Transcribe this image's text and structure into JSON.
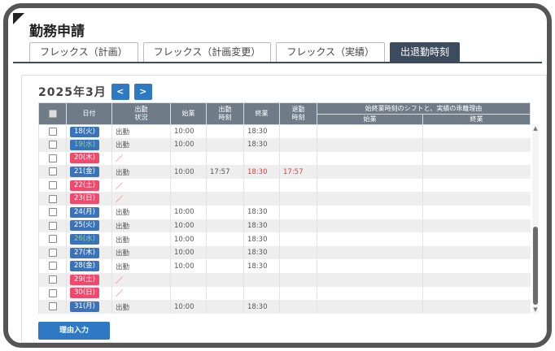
{
  "page_title": "勤務申請",
  "tabs": [
    {
      "label": "フレックス（計画）",
      "active": false
    },
    {
      "label": "フレックス（計画変更）",
      "active": false
    },
    {
      "label": "フレックス（実績）",
      "active": false
    },
    {
      "label": "出退勤時刻",
      "active": true
    }
  ],
  "month_label": "2025年3月",
  "nav": {
    "prev": "<",
    "next": ">"
  },
  "table": {
    "headers": {
      "date": "日付",
      "status": "出勤\n状況",
      "start": "始業",
      "clock_in": "出勤\n時刻",
      "end": "終業",
      "clock_out": "退勤\n時刻",
      "reason_group": "始終業時刻のシフトと、実績の乖離理由",
      "reason_start": "始業",
      "reason_end": "終業"
    },
    "rows": [
      {
        "date": "18(火)",
        "day_type": "weekday",
        "status": "出勤",
        "start": "10:00",
        "clock_in": "",
        "end": "18:30",
        "clock_out": "",
        "late": false
      },
      {
        "date": "19(水)",
        "day_type": "holiday",
        "status": "出勤",
        "start": "10:00",
        "clock_in": "",
        "end": "18:30",
        "clock_out": "",
        "late": false
      },
      {
        "date": "20(木)",
        "day_type": "weekend",
        "status": "／",
        "start": "",
        "clock_in": "",
        "end": "",
        "clock_out": "",
        "late": false
      },
      {
        "date": "21(金)",
        "day_type": "weekday",
        "status": "出勤",
        "start": "10:00",
        "clock_in": "17:57",
        "end": "18:30",
        "clock_out": "17:57",
        "late": true
      },
      {
        "date": "22(土)",
        "day_type": "weekend",
        "status": "／",
        "start": "",
        "clock_in": "",
        "end": "",
        "clock_out": "",
        "late": false
      },
      {
        "date": "23(日)",
        "day_type": "weekend",
        "status": "／",
        "start": "",
        "clock_in": "",
        "end": "",
        "clock_out": "",
        "late": false
      },
      {
        "date": "24(月)",
        "day_type": "weekday",
        "status": "出勤",
        "start": "10:00",
        "clock_in": "",
        "end": "18:30",
        "clock_out": "",
        "late": false
      },
      {
        "date": "25(火)",
        "day_type": "weekday",
        "status": "出勤",
        "start": "10:00",
        "clock_in": "",
        "end": "18:30",
        "clock_out": "",
        "late": false
      },
      {
        "date": "26(水)",
        "day_type": "holiday",
        "status": "出勤",
        "start": "10:00",
        "clock_in": "",
        "end": "18:30",
        "clock_out": "",
        "late": false
      },
      {
        "date": "27(木)",
        "day_type": "weekday",
        "status": "出勤",
        "start": "10:00",
        "clock_in": "",
        "end": "18:30",
        "clock_out": "",
        "late": false
      },
      {
        "date": "28(金)",
        "day_type": "weekday",
        "status": "出勤",
        "start": "10:00",
        "clock_in": "",
        "end": "18:30",
        "clock_out": "",
        "late": false
      },
      {
        "date": "29(土)",
        "day_type": "weekend",
        "status": "／",
        "start": "",
        "clock_in": "",
        "end": "",
        "clock_out": "",
        "late": false
      },
      {
        "date": "30(日)",
        "day_type": "weekend",
        "status": "／",
        "start": "",
        "clock_in": "",
        "end": "",
        "clock_out": "",
        "late": false
      },
      {
        "date": "31(月)",
        "day_type": "weekday",
        "status": "出勤",
        "start": "10:00",
        "clock_in": "",
        "end": "18:30",
        "clock_out": "",
        "late": false
      }
    ]
  },
  "reason_button": "理由入力",
  "colors": {
    "weekday": "#3a73b9",
    "weekend": "#ef4a6b",
    "holiday": "#3a73b9",
    "holiday_text": "#8fd37a",
    "late_text": "#e53935",
    "accent": "#2f78c4"
  }
}
